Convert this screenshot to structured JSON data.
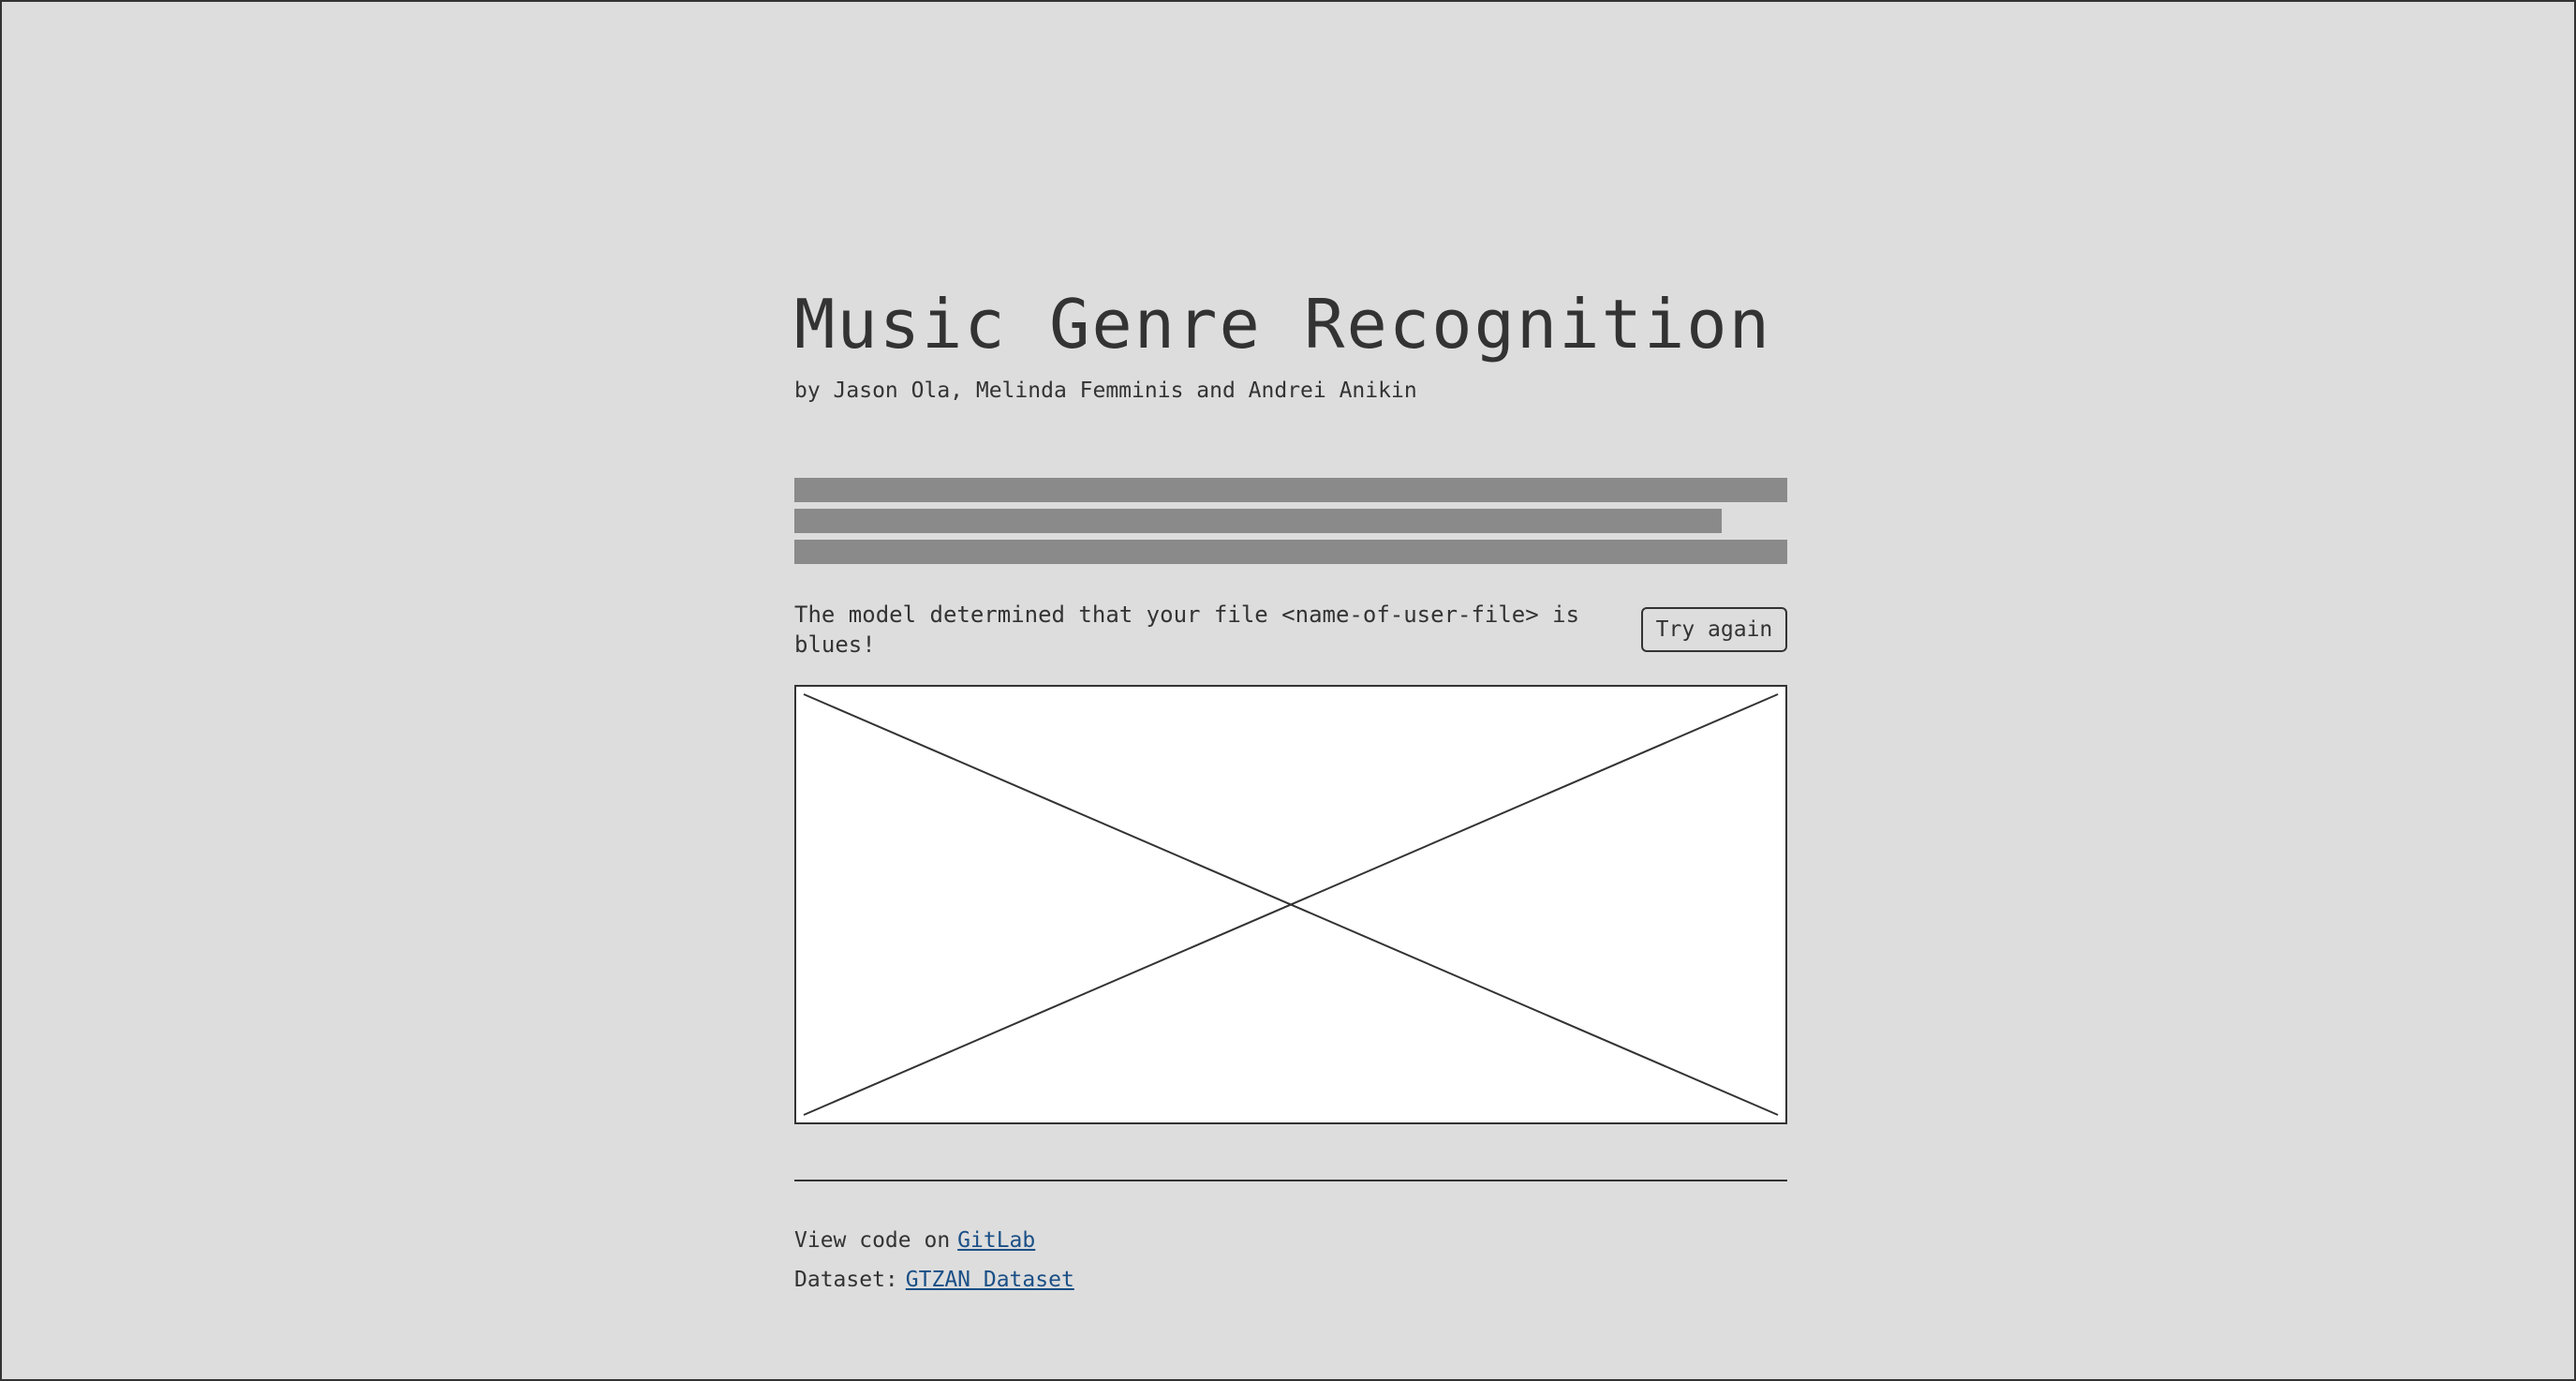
{
  "page": {
    "title": "Music Genre Recognition",
    "authors": "by Jason Ola, Melinda Femminis and Andrei Anikin"
  },
  "result": {
    "message": "The model determined that your file <name-of-user-file> is blues!",
    "try_again_label": "Try again"
  },
  "footer": {
    "code_prefix": "View code on",
    "code_link_label": "GitLab",
    "dataset_prefix": "Dataset:",
    "dataset_link_label": "GTZAN Dataset"
  },
  "colors": {
    "background": "#dddddd",
    "text": "#333333",
    "placeholder_bar": "#8a8a8a",
    "link": "#1a4f86"
  }
}
